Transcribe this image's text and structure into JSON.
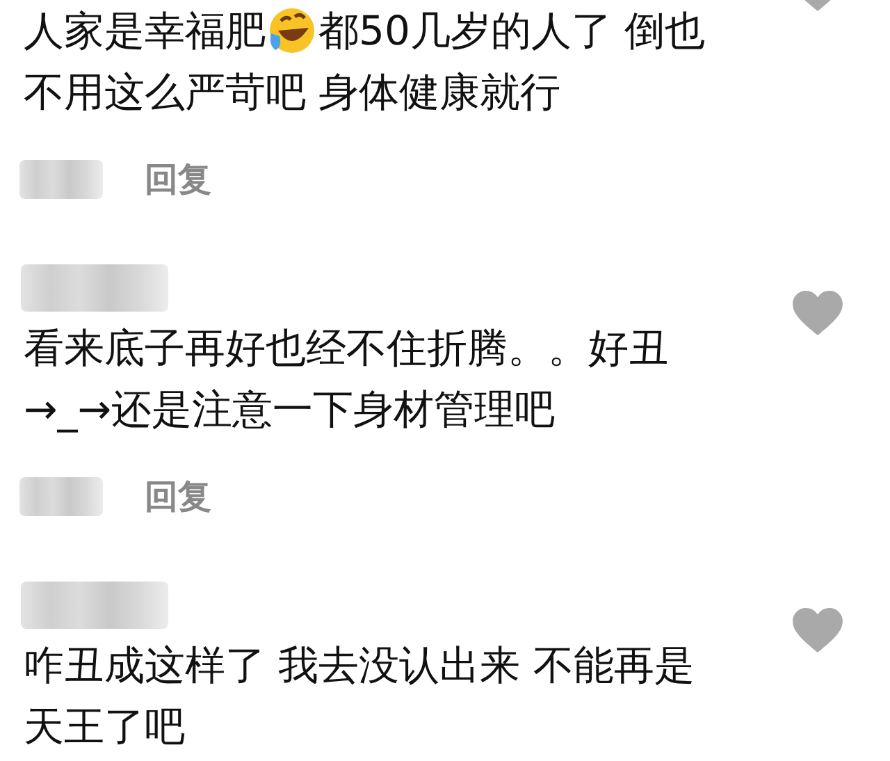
{
  "comments": [
    {
      "header_visible": false,
      "lines": [
        [
          {
            "kind": "text",
            "text": "人家是幸福肥"
          },
          {
            "kind": "emoji"
          },
          {
            "kind": "text",
            "text": "都50几岁的人了 倒也"
          }
        ],
        [
          {
            "kind": "text",
            "text": "不用这么严苛吧 身体健康就行"
          }
        ]
      ],
      "reply": "回复"
    },
    {
      "header_visible": true,
      "lines": [
        [
          {
            "kind": "text",
            "text": "看来底子再好也经不住折腾。。好丑"
          }
        ],
        [
          {
            "kind": "text",
            "text": "→_→还是注意一下身材管理吧"
          }
        ]
      ],
      "reply": "回复"
    },
    {
      "header_visible": true,
      "lines": [
        [
          {
            "kind": "text",
            "text": "咋丑成这样了 我去没认出来 不能再是"
          }
        ],
        [
          {
            "kind": "text",
            "text": "天王了吧"
          }
        ]
      ]
    }
  ]
}
